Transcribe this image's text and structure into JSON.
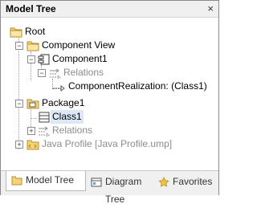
{
  "panel": {
    "title": "Model Tree",
    "close_glyph": "×"
  },
  "tree": {
    "root": "Root",
    "component_view": "Component View",
    "component1": "Component1",
    "relations1": "Relations",
    "realization_name": "ComponentRealization:",
    "realization_target": "(Class1)",
    "package1": "Package1",
    "class1": "Class1",
    "relations2": "Relations",
    "java_profile": "Java Profile [Java Profile.ump]"
  },
  "tabs": [
    {
      "label": "Model Tree",
      "icon": "model-tree-icon",
      "active": true
    },
    {
      "label": "Diagram Tree",
      "icon": "diagram-tree-icon",
      "active": false
    },
    {
      "label": "Favorites",
      "icon": "favorites-icon",
      "active": false
    }
  ],
  "colors": {
    "folder": "#f5d37a",
    "selection": "#dce8f8",
    "greyed": "#8c8c8c"
  }
}
